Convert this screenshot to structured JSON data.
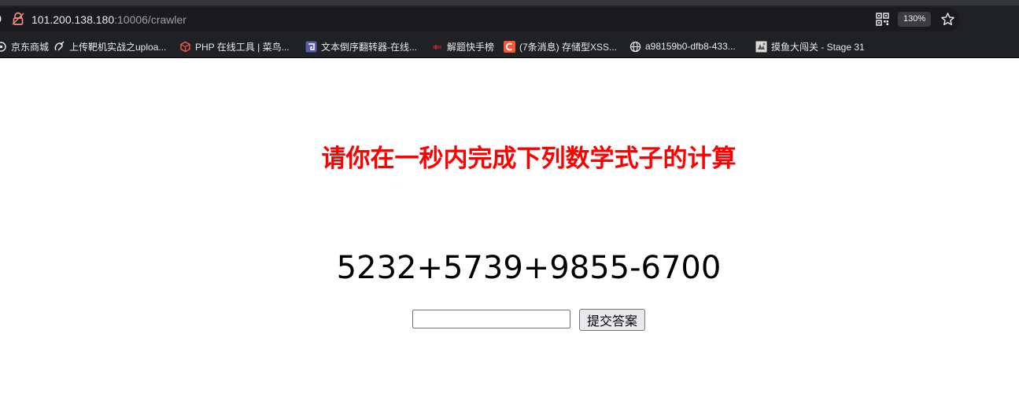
{
  "browser": {
    "url_host": "101.200.138.180",
    "url_path": ":10006/crawler",
    "zoom": "130%",
    "icons": {
      "site": "lock-icon",
      "qr": "qr-code-icon",
      "bookmark": "star-icon"
    },
    "bookmarks": [
      {
        "label": "京东商城",
        "icon": "jd-icon"
      },
      {
        "label": "上传靶机实战之uploa...",
        "icon": "upload-lab-icon"
      },
      {
        "label": "PHP 在线工具 | 菜鸟...",
        "icon": "runoob-icon"
      },
      {
        "label": "文本倒序翻转器-在线...",
        "icon": "reverse-text-icon"
      },
      {
        "label": "解题快手榜",
        "icon": "ranking-icon"
      },
      {
        "label": "(7条消息) 存储型XSS...",
        "icon": "csdn-icon"
      },
      {
        "label": "a98159b0-dfb8-433...",
        "icon": "globe-icon"
      },
      {
        "label": "摸鱼大闯关 - Stage 31",
        "icon": "game-icon"
      }
    ]
  },
  "page": {
    "heading": "请你在一秒内完成下列数学式子的计算",
    "expression": "5232+5739+9855-6700",
    "answer_value": "",
    "submit_label": "提交答案",
    "heading_color": "#ff0000"
  }
}
